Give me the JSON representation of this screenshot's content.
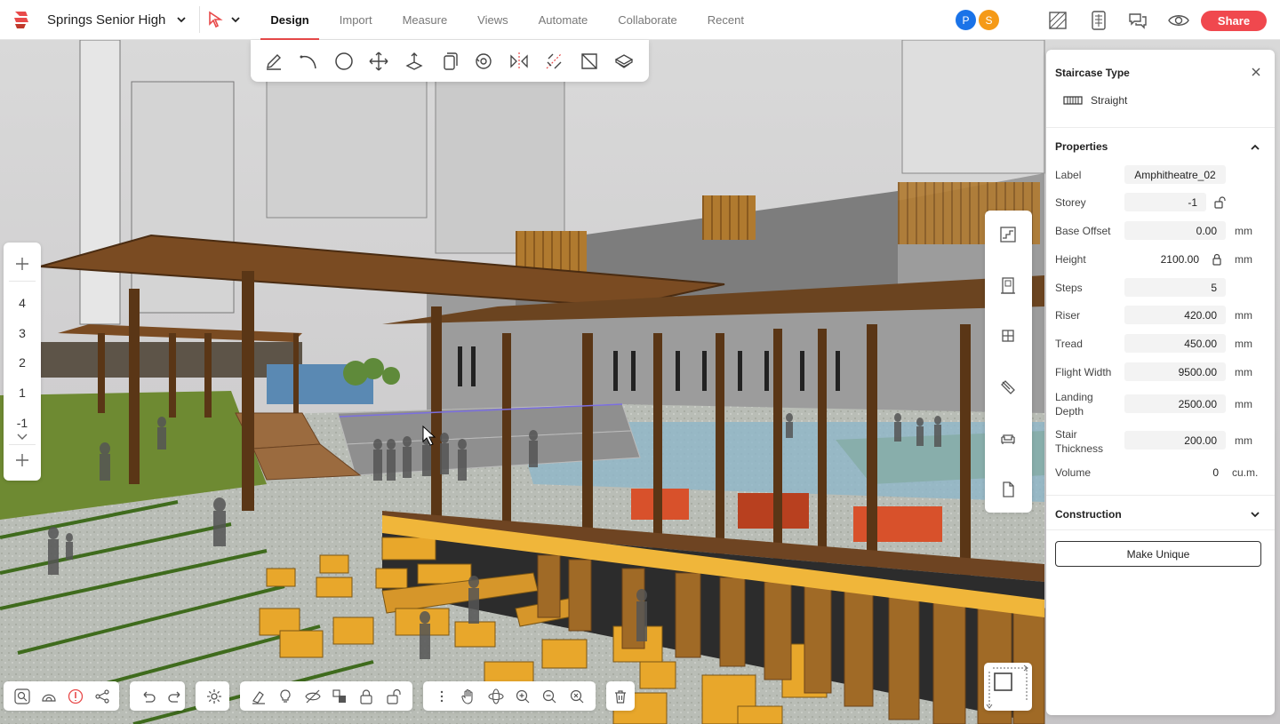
{
  "app": {
    "project_name": "Springs Senior High",
    "brand_color": "#e84a4a"
  },
  "nav": {
    "tabs": [
      "Design",
      "Import",
      "Measure",
      "Views",
      "Automate",
      "Collaborate",
      "Recent"
    ],
    "active_tab": "Design"
  },
  "collaborators": [
    {
      "initial": "P",
      "color": "#1a73e8"
    },
    {
      "initial": "S",
      "color": "#f59a17"
    }
  ],
  "header_icons": [
    "plan-view-icon",
    "spreadsheet-icon",
    "comments-icon",
    "preview-eye-icon"
  ],
  "share_label": "Share",
  "tools": [
    "pencil-icon",
    "arc-icon",
    "circle-icon",
    "move-icon",
    "push-pull-icon",
    "copy-icon",
    "rotate-icon",
    "mirror-icon",
    "align-icon",
    "face-icon",
    "paint-bucket-icon"
  ],
  "storeys": {
    "levels": [
      "4",
      "3",
      "2",
      "1",
      "-1"
    ]
  },
  "side_icons": [
    "staircase-icon",
    "door-icon",
    "window-icon",
    "paint-roller-icon",
    "furniture-sofa-icon",
    "document-icon"
  ],
  "panel": {
    "title": "Staircase Type",
    "stair_type": "Straight",
    "properties_title": "Properties",
    "construction_title": "Construction",
    "make_unique_label": "Make Unique",
    "properties": [
      {
        "label": "Label",
        "value": "Amphitheatre_02",
        "unit": ""
      },
      {
        "label": "Storey",
        "value": "-1",
        "unit": ""
      },
      {
        "label": "Base Offset",
        "value": "0.00",
        "unit": "mm"
      },
      {
        "label": "Height",
        "value": "2100.00",
        "unit": "mm"
      },
      {
        "label": "Steps",
        "value": "5",
        "unit": ""
      },
      {
        "label": "Riser",
        "value": "420.00",
        "unit": "mm"
      },
      {
        "label": "Tread",
        "value": "450.00",
        "unit": "mm"
      },
      {
        "label": "Flight Width",
        "value": "9500.00",
        "unit": "mm"
      },
      {
        "label": "Landing Depth",
        "value": "2500.00",
        "unit": "mm"
      },
      {
        "label": "Stair Thickness",
        "value": "200.00",
        "unit": "mm"
      },
      {
        "label": "Volume",
        "value": "0",
        "unit": "cu.m."
      }
    ]
  },
  "bottom_toolbar": {
    "view_group": [
      "search-view-icon",
      "dome-icon",
      "info-alert-icon",
      "share-nodes-icon"
    ],
    "history_group": [
      "undo-icon",
      "redo-icon"
    ],
    "settings_group": [
      "settings-gear-icon"
    ],
    "display_group": [
      "eraser-icon",
      "light-bulb-icon",
      "hide-icon",
      "layers-icon",
      "lock-icon",
      "unlock-icon"
    ],
    "navigation_group": [
      "more-icon",
      "pan-hand-icon",
      "orbit-icon",
      "zoom-in-icon",
      "zoom-out-icon",
      "zoom-extents-icon"
    ],
    "delete_group": [
      "trash-icon"
    ]
  }
}
